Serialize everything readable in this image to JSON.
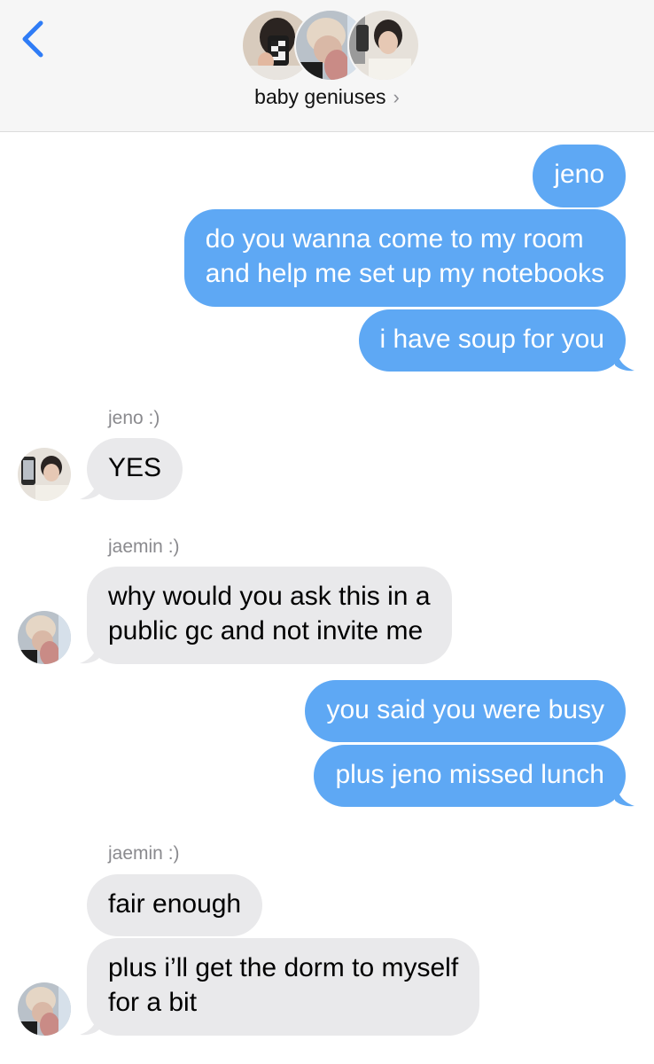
{
  "header": {
    "back_icon": "chevron-left-icon",
    "group_name": "baby geniuses",
    "group_chevron": "›",
    "accent_color": "#2f7cf6"
  },
  "messages": [
    {
      "id": "m1",
      "side": "out",
      "text": "jeno"
    },
    {
      "id": "m2",
      "side": "out",
      "lines": [
        "do you wanna come to my room",
        "and help me set up my notebooks"
      ]
    },
    {
      "id": "m3",
      "side": "out",
      "text": "i have soup for you"
    },
    {
      "id": "s1",
      "sender": "jeno :)"
    },
    {
      "id": "m4",
      "side": "in",
      "text": "YES"
    },
    {
      "id": "s2",
      "sender": "jaemin :)"
    },
    {
      "id": "m5",
      "side": "in",
      "lines": [
        "why would you ask this in a",
        "public gc and not invite me"
      ]
    },
    {
      "id": "m6",
      "side": "out",
      "text": "you said you were busy"
    },
    {
      "id": "m7",
      "side": "out",
      "text": "plus jeno missed lunch"
    },
    {
      "id": "s3",
      "sender": "jaemin :)"
    },
    {
      "id": "m8",
      "side": "in",
      "text": "fair enough"
    },
    {
      "id": "m9",
      "side": "in",
      "lines": [
        "plus i’ll get the dorm to myself",
        "for a bit"
      ]
    }
  ],
  "colors": {
    "outgoing_bubble": "#5ea8f4",
    "incoming_bubble": "#e9e9eb",
    "sender_label": "#8a8a8e"
  }
}
